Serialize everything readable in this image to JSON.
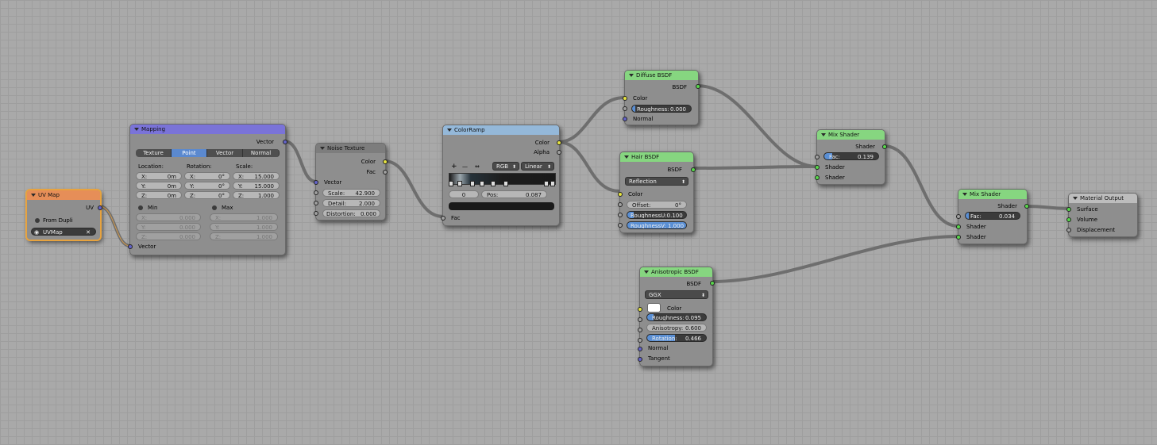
{
  "nodes": {
    "uvmap": {
      "title": "UV Map",
      "output": "UV",
      "from_dupli": "From Dupli",
      "map": "UVMap"
    },
    "mapping": {
      "title": "Mapping",
      "output": "Vector",
      "input": "Vector",
      "tabs": [
        "Texture",
        "Point",
        "Vector",
        "Normal"
      ],
      "active_tab": "Point",
      "location": {
        "label": "Location:",
        "x": "0m",
        "y": "0m",
        "z": "0m"
      },
      "rotation": {
        "label": "Rotation:",
        "x": "0°",
        "y": "0°",
        "z": "0°"
      },
      "scale": {
        "label": "Scale:",
        "x": "15.000",
        "y": "15.000",
        "z": "1.000"
      },
      "min": {
        "label": "Min",
        "x": "0.000",
        "y": "0.000",
        "z": "0.000"
      },
      "max": {
        "label": "Max",
        "x": "1.000",
        "y": "1.000",
        "z": "1.000"
      },
      "axis": {
        "x": "X:",
        "y": "Y:",
        "z": "Z:"
      }
    },
    "noise": {
      "title": "Noise Texture",
      "out_color": "Color",
      "out_fac": "Fac",
      "input": "Vector",
      "scale": {
        "label": "Scale:",
        "value": "42.900"
      },
      "detail": {
        "label": "Detail:",
        "value": "2.000"
      },
      "distortion": {
        "label": "Distortion:",
        "value": "0.000"
      }
    },
    "colorramp": {
      "title": "ColorRamp",
      "out_color": "Color",
      "out_alpha": "Alpha",
      "input": "Fac",
      "mode": "RGB",
      "interp": "Linear",
      "index": "0",
      "pos_label": "Pos:",
      "pos_value": "0.087",
      "buttons": {
        "add": "+",
        "remove": "—",
        "flip": "⇔"
      }
    },
    "diffuse": {
      "title": "Diffuse BSDF",
      "output": "BSDF",
      "color": "Color",
      "roughness_label": "Roughness:",
      "roughness": "0.000",
      "normal": "Normal"
    },
    "hair": {
      "title": "Hair BSDF",
      "output": "BSDF",
      "component": "Reflection",
      "color": "Color",
      "offset_label": "Offset:",
      "offset": "0°",
      "roughness_u": "RoughnessU:0.100",
      "roughness_v": "RoughnessV: 1.000"
    },
    "aniso": {
      "title": "Anisotropic BSDF",
      "output": "BSDF",
      "distribution": "GGX",
      "color": "Color",
      "roughness_label": "Roughness:",
      "roughness": "0.095",
      "anisotropy_label": "Anisotropy:",
      "anisotropy": "0.600",
      "rotation_label": "Rotation:",
      "rotation": "0.466",
      "normal": "Normal",
      "tangent": "Tangent"
    },
    "mix1": {
      "title": "Mix Shader",
      "output": "Shader",
      "fac_label": "Fac:",
      "fac": "0.139",
      "shader1": "Shader",
      "shader2": "Shader"
    },
    "mix2": {
      "title": "Mix Shader",
      "output": "Shader",
      "fac_label": "Fac:",
      "fac": "0.034",
      "shader1": "Shader",
      "shader2": "Shader"
    },
    "output": {
      "title": "Material Output",
      "surface": "Surface",
      "volume": "Volume",
      "displacement": "Displacement"
    }
  },
  "colors": {
    "background": "#a9a9a9",
    "wire": "#707070",
    "socket_color": "#e6e341",
    "socket_float": "#a0a0a0",
    "socket_vector": "#6363c7",
    "socket_shader": "#58d64c",
    "header_input": "#e68e58",
    "header_vector": "#7a73d8",
    "header_converter": "#94b8d9",
    "header_shader": "#86d680"
  }
}
